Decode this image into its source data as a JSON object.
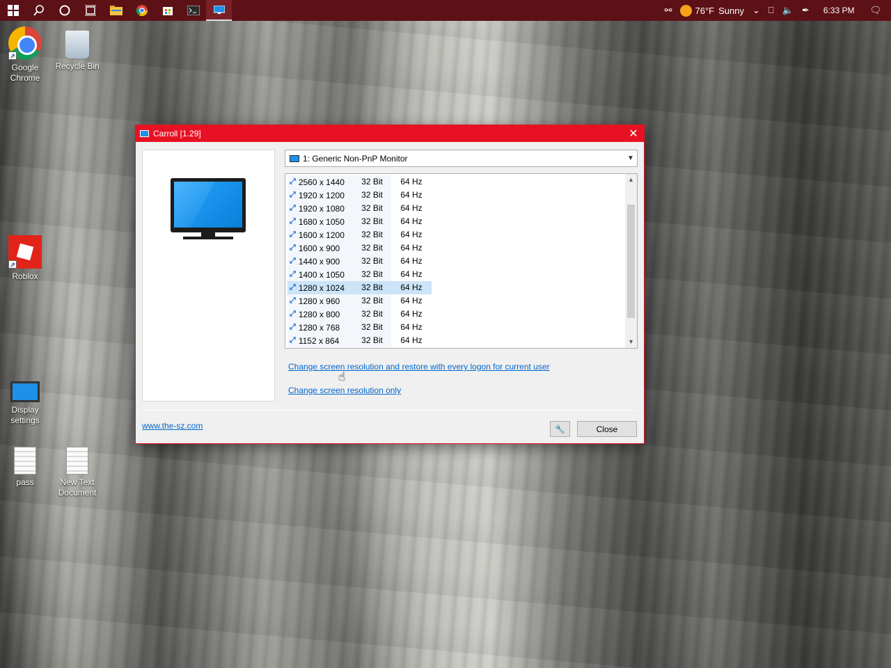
{
  "taskbar": {
    "icons": [
      "windows-icon",
      "search-icon",
      "cortana-icon",
      "task-view-icon",
      "file-explorer-icon",
      "chrome-icon",
      "store-icon",
      "terminal-icon",
      "carroll-icon"
    ],
    "weather_temp": "76°F",
    "weather_text": "Sunny",
    "clock": "6:33 PM"
  },
  "desktop": {
    "chrome": "Google Chrome",
    "recycle_bin": "Recycle Bin",
    "roblox": "Roblox",
    "display": "Display settings",
    "pass": "pass",
    "new_text": "New Text Document"
  },
  "window": {
    "title": "Carroll [1.29]",
    "monitor_select": "1: Generic Non-PnP Monitor",
    "modes": [
      {
        "res": "2560 x 1440",
        "bit": "32 Bit",
        "hz": "64 Hz"
      },
      {
        "res": "1920 x 1200",
        "bit": "32 Bit",
        "hz": "64 Hz"
      },
      {
        "res": "1920 x 1080",
        "bit": "32 Bit",
        "hz": "64 Hz"
      },
      {
        "res": "1680 x 1050",
        "bit": "32 Bit",
        "hz": "64 Hz"
      },
      {
        "res": "1600 x 1200",
        "bit": "32 Bit",
        "hz": "64 Hz"
      },
      {
        "res": "1600 x 900",
        "bit": "32 Bit",
        "hz": "64 Hz"
      },
      {
        "res": "1440 x 900",
        "bit": "32 Bit",
        "hz": "64 Hz"
      },
      {
        "res": "1400 x 1050",
        "bit": "32 Bit",
        "hz": "64 Hz"
      },
      {
        "res": "1280 x 1024",
        "bit": "32 Bit",
        "hz": "64 Hz"
      },
      {
        "res": "1280 x 960",
        "bit": "32 Bit",
        "hz": "64 Hz"
      },
      {
        "res": "1280 x 800",
        "bit": "32 Bit",
        "hz": "64 Hz"
      },
      {
        "res": "1280 x 768",
        "bit": "32 Bit",
        "hz": "64 Hz"
      },
      {
        "res": "1152 x 864",
        "bit": "32 Bit",
        "hz": "64 Hz"
      }
    ],
    "selected_mode": "1280 x 1024",
    "link_restore": "Change screen resolution and restore with every logon for current user",
    "link_only": "Change screen resolution only",
    "website": "www.the-sz.com",
    "close_label": "Close",
    "accent_color": "#e81123"
  }
}
